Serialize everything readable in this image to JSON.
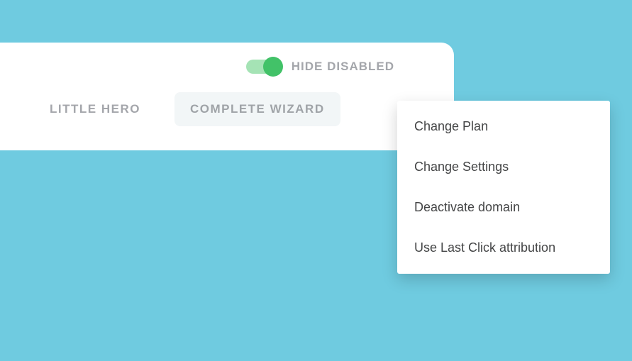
{
  "toggle": {
    "label": "HIDE DISABLED",
    "on": true
  },
  "tabs": [
    {
      "label": "LITTLE HERO",
      "active": false
    },
    {
      "label": "COMPLETE WIZARD",
      "active": true
    }
  ],
  "menu": {
    "items": [
      {
        "label": "Change Plan"
      },
      {
        "label": "Change Settings"
      },
      {
        "label": "Deactivate domain"
      },
      {
        "label": "Use Last Click attribution"
      }
    ]
  }
}
